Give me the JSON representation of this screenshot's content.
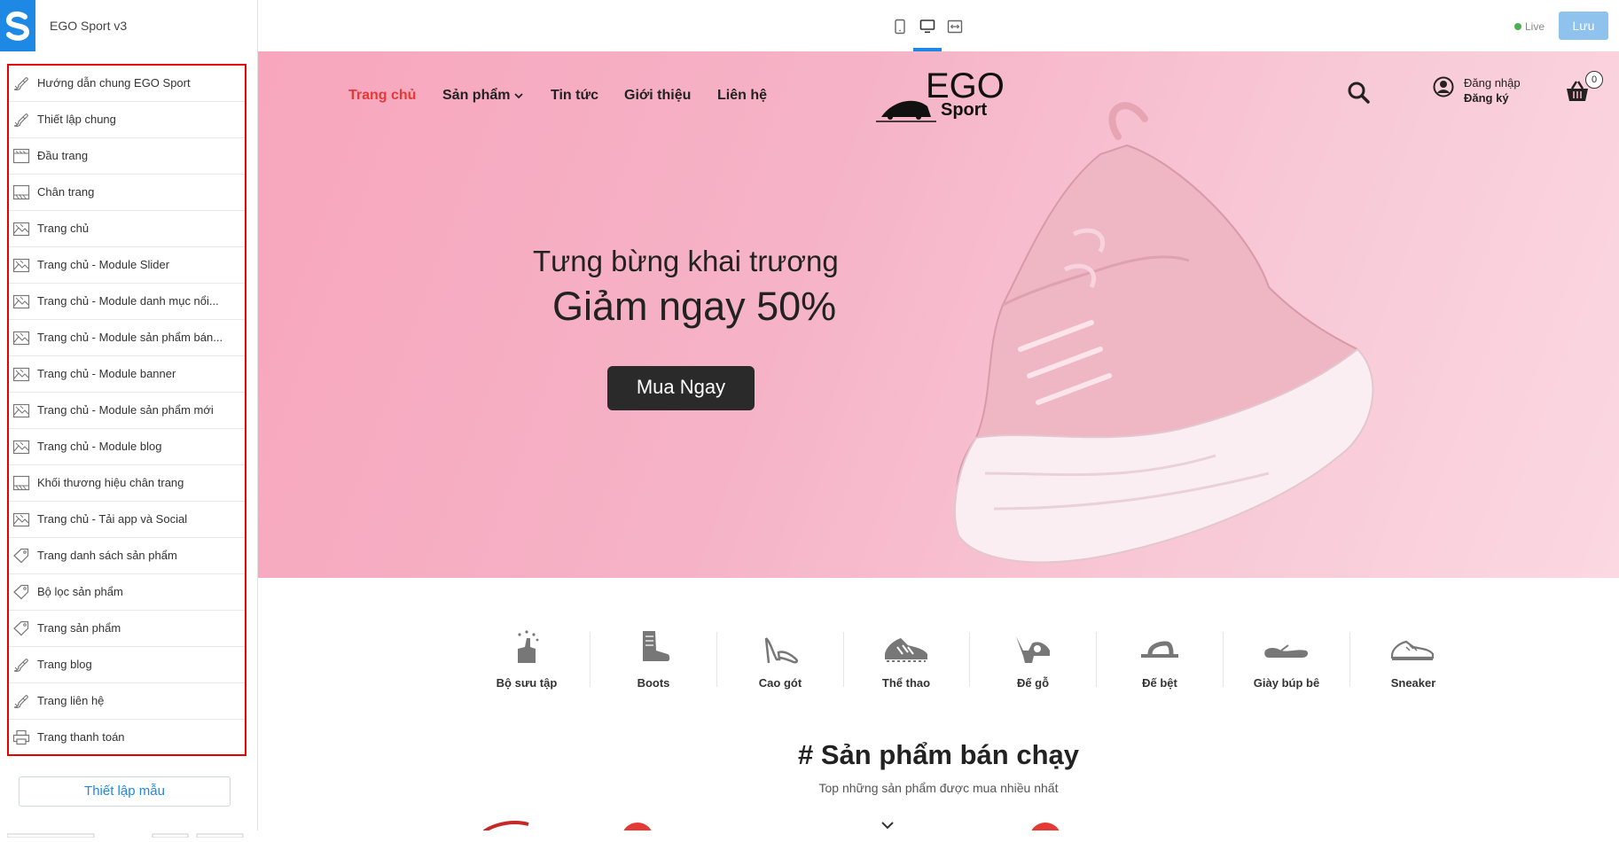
{
  "editor": {
    "store_name": "EGO Sport v3",
    "live_label": "Live",
    "save_label": "Lưu",
    "template_settings_label": "Thiết lập mẫu"
  },
  "sections": [
    {
      "label": "Hướng dẫn chung EGO Sport",
      "icon": "brush-icon"
    },
    {
      "label": "Thiết lập chung",
      "icon": "brush-icon"
    },
    {
      "label": "Đầu trang",
      "icon": "header-layout-icon"
    },
    {
      "label": "Chân trang",
      "icon": "footer-layout-icon"
    },
    {
      "label": "Trang chủ",
      "icon": "image-icon"
    },
    {
      "label": "Trang chủ - Module Slider",
      "icon": "image-icon"
    },
    {
      "label": "Trang chủ - Module danh mục nổi...",
      "icon": "image-icon"
    },
    {
      "label": "Trang chủ - Module sản phẩm bán...",
      "icon": "image-icon"
    },
    {
      "label": "Trang chủ - Module banner",
      "icon": "image-icon"
    },
    {
      "label": "Trang chủ - Module sản phẩm mới",
      "icon": "image-icon"
    },
    {
      "label": "Trang chủ - Module blog",
      "icon": "image-icon"
    },
    {
      "label": "Khối thương hiệu chân trang",
      "icon": "footer-layout-icon"
    },
    {
      "label": "Trang chủ - Tải app và Social",
      "icon": "image-icon"
    },
    {
      "label": "Trang danh sách sản phẩm",
      "icon": "tag-icon"
    },
    {
      "label": "Bộ lọc sản phẩm",
      "icon": "tag-icon"
    },
    {
      "label": "Trang sản phẩm",
      "icon": "tag-icon"
    },
    {
      "label": "Trang blog",
      "icon": "brush-icon"
    },
    {
      "label": "Trang liên hệ",
      "icon": "brush-icon"
    },
    {
      "label": "Trang thanh toán",
      "icon": "printer-icon"
    }
  ],
  "site": {
    "nav": {
      "home": "Trang chủ",
      "products": "Sản phẩm",
      "news": "Tin tức",
      "about": "Giới thiệu",
      "contact": "Liên hệ"
    },
    "brand_top": "EGO",
    "brand_bottom": "Sport",
    "login": "Đăng nhập",
    "register": "Đăng ký",
    "cart_count": "0",
    "hero": {
      "line1": "Tưng bừng khai trương",
      "line2": "Giảm ngay 50%",
      "cta": "Mua Ngay"
    },
    "categories": [
      {
        "label": "Bộ sưu tập",
        "icon": "collection-icon"
      },
      {
        "label": "Boots",
        "icon": "boot-icon"
      },
      {
        "label": "Cao gót",
        "icon": "high-heel-icon"
      },
      {
        "label": "Thể thao",
        "icon": "sport-shoe-icon"
      },
      {
        "label": "Đế gỗ",
        "icon": "wooden-sole-icon"
      },
      {
        "label": "Đế bệt",
        "icon": "flat-sandal-icon"
      },
      {
        "label": "Giày búp bê",
        "icon": "ballet-flat-icon"
      },
      {
        "label": "Sneaker",
        "icon": "sneaker-icon"
      }
    ],
    "bestsellers_title": "# Sản phẩm bán chạy",
    "bestsellers_subtitle": "Top những sản phẩm được mua nhiều nhất"
  },
  "colors": {
    "accent": "#1e88e5",
    "nav_active": "#e53935",
    "highlight_border": "#e60000",
    "hero_bg": "#f7b3c6"
  }
}
